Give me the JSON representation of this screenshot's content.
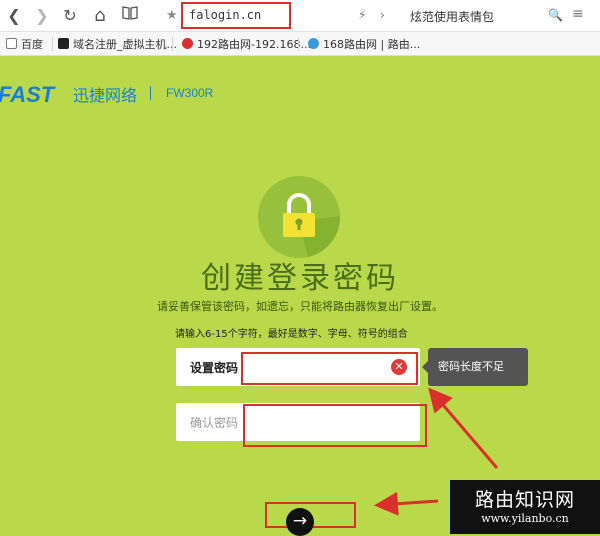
{
  "browser": {
    "nav": {
      "back": "❮",
      "forward": "❯",
      "reload": "↻",
      "home": "⌂",
      "reader": "📖"
    },
    "url": "falogin.cn",
    "right_text": "炫范使用表情包",
    "search_placeholder": "🔍",
    "menu": "≡",
    "bookmarks": [
      {
        "label": "百度",
        "color": "#4e6ef2"
      },
      {
        "label": "域名注册_虚拟主机...",
        "color": "#222222"
      },
      {
        "label": "192路由网-192.168...",
        "color": "#d9302b"
      },
      {
        "label": "168路由网 | 路由...",
        "color": "#3a9ad9"
      }
    ]
  },
  "brand": {
    "logo": "FAST",
    "name_cn": "迅捷网络",
    "model": "FW300R",
    "accent": "#1b7fd1"
  },
  "page": {
    "title": "创建登录密码",
    "subtitle": "请妥善保管该密码，如遗忘，只能将路由器恢复出厂设置。",
    "hint": "请输入6-15个字符，最好是数字、字母、符号的组合",
    "password_label": "设置密码",
    "password_value": "",
    "confirm_label": "确认密码",
    "confirm_value": "",
    "clear": "✕",
    "tooltip": "密码长度不足",
    "next": "→",
    "background": "#b9d94a"
  },
  "watermark": {
    "title": "路由知识网",
    "url": "www.yilanbo.cn"
  }
}
